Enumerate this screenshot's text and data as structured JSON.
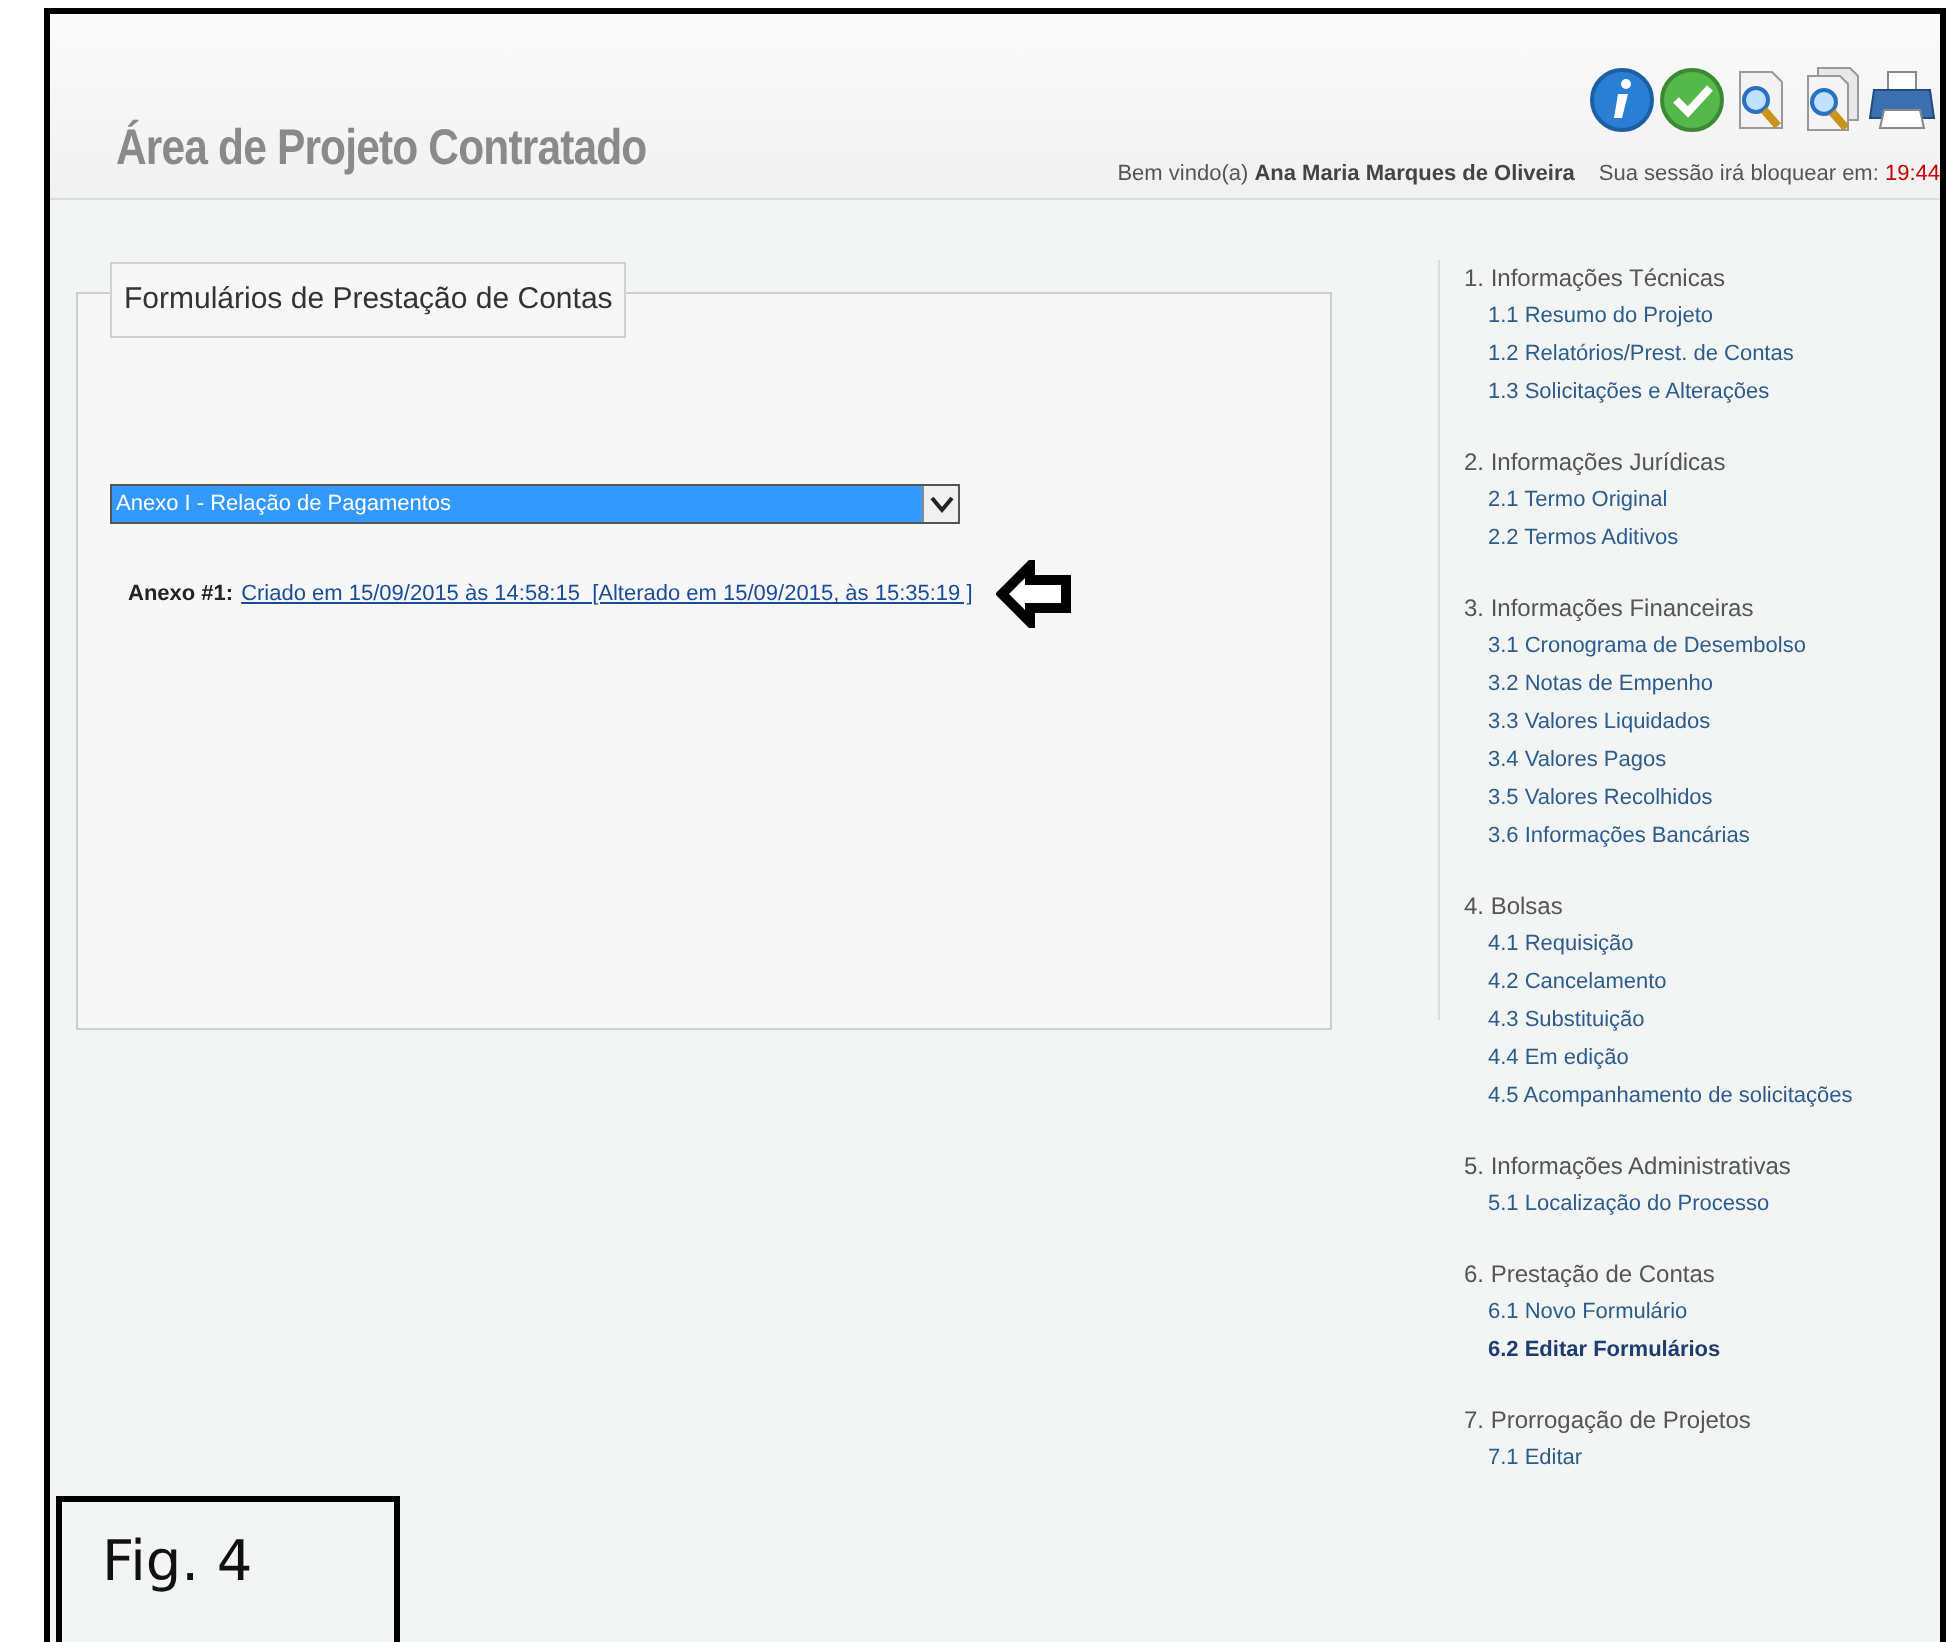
{
  "header": {
    "title": "Área de Projeto Contratado",
    "toolbar": [
      {
        "kind": "info"
      },
      {
        "kind": "check"
      },
      {
        "kind": "zoom"
      },
      {
        "kind": "zoom-pages"
      },
      {
        "kind": "printer"
      }
    ],
    "welcome_label": "Bem vindo(a)",
    "user_name": "Ana Maria Marques de Oliveira",
    "session_label": "Sua sessão irá bloquear em:",
    "session_time": "19:44"
  },
  "form_panel": {
    "legend": "Formulários de Prestação de Contas",
    "select": {
      "value": "Anexo I - Relação de Pagamentos"
    },
    "annex_label": "Anexo #1:",
    "annex_link": "Criado em 15/09/2015 às 14:58:15  [Alterado em 15/09/2015, às 15:35:19 ]"
  },
  "menu": [
    {
      "heading": "1. Informações Técnicas",
      "items": [
        {
          "label": "1.1 Resumo do Projeto",
          "selected": false
        },
        {
          "label": "1.2 Relatórios/Prest. de Contas",
          "selected": false
        },
        {
          "label": "1.3 Solicitações e Alterações",
          "selected": false
        }
      ]
    },
    {
      "heading": "2. Informações Jurídicas",
      "items": [
        {
          "label": "2.1 Termo Original",
          "selected": false
        },
        {
          "label": "2.2 Termos Aditivos",
          "selected": false
        }
      ]
    },
    {
      "heading": "3. Informações Financeiras",
      "items": [
        {
          "label": "3.1 Cronograma de Desembolso",
          "selected": false
        },
        {
          "label": "3.2 Notas de Empenho",
          "selected": false
        },
        {
          "label": "3.3 Valores Liquidados",
          "selected": false
        },
        {
          "label": "3.4 Valores Pagos",
          "selected": false
        },
        {
          "label": "3.5 Valores Recolhidos",
          "selected": false
        },
        {
          "label": "3.6 Informações Bancárias",
          "selected": false
        }
      ]
    },
    {
      "heading": "4. Bolsas",
      "items": [
        {
          "label": "4.1 Requisição",
          "selected": false
        },
        {
          "label": "4.2 Cancelamento",
          "selected": false
        },
        {
          "label": "4.3 Substituição",
          "selected": false
        },
        {
          "label": "4.4 Em edição",
          "selected": false
        },
        {
          "label": "4.5 Acompanhamento de solicitações",
          "selected": false
        }
      ]
    },
    {
      "heading": "5. Informações Administrativas",
      "items": [
        {
          "label": "5.1 Localização do Processo",
          "selected": false
        }
      ]
    },
    {
      "heading": "6. Prestação de Contas",
      "items": [
        {
          "label": "6.1 Novo Formulário",
          "selected": false
        },
        {
          "label": "6.2 Editar Formulários",
          "selected": true
        }
      ]
    },
    {
      "heading": "7. Prorrogação de Projetos",
      "items": [
        {
          "label": "7.1 Editar",
          "selected": false
        }
      ]
    }
  ],
  "figure_label": "Fig. 4"
}
